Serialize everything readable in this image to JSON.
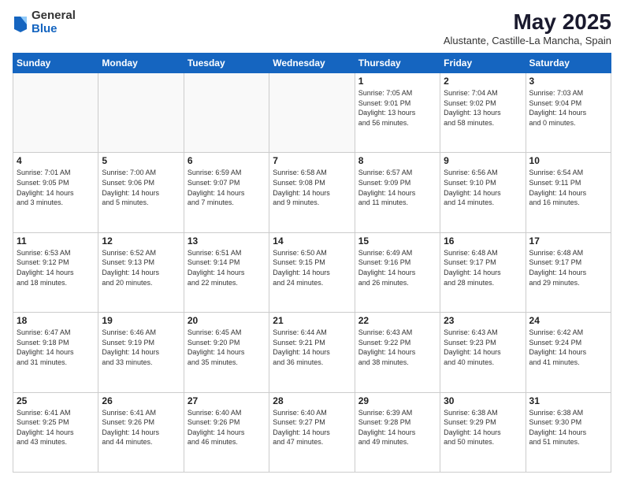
{
  "logo": {
    "general": "General",
    "blue": "Blue"
  },
  "header": {
    "month": "May 2025",
    "location": "Alustante, Castille-La Mancha, Spain"
  },
  "weekdays": [
    "Sunday",
    "Monday",
    "Tuesday",
    "Wednesday",
    "Thursday",
    "Friday",
    "Saturday"
  ],
  "days": [
    {
      "num": "",
      "info": ""
    },
    {
      "num": "",
      "info": ""
    },
    {
      "num": "",
      "info": ""
    },
    {
      "num": "",
      "info": ""
    },
    {
      "num": "1",
      "info": "Sunrise: 7:05 AM\nSunset: 9:01 PM\nDaylight: 13 hours\nand 56 minutes."
    },
    {
      "num": "2",
      "info": "Sunrise: 7:04 AM\nSunset: 9:02 PM\nDaylight: 13 hours\nand 58 minutes."
    },
    {
      "num": "3",
      "info": "Sunrise: 7:03 AM\nSunset: 9:04 PM\nDaylight: 14 hours\nand 0 minutes."
    },
    {
      "num": "4",
      "info": "Sunrise: 7:01 AM\nSunset: 9:05 PM\nDaylight: 14 hours\nand 3 minutes."
    },
    {
      "num": "5",
      "info": "Sunrise: 7:00 AM\nSunset: 9:06 PM\nDaylight: 14 hours\nand 5 minutes."
    },
    {
      "num": "6",
      "info": "Sunrise: 6:59 AM\nSunset: 9:07 PM\nDaylight: 14 hours\nand 7 minutes."
    },
    {
      "num": "7",
      "info": "Sunrise: 6:58 AM\nSunset: 9:08 PM\nDaylight: 14 hours\nand 9 minutes."
    },
    {
      "num": "8",
      "info": "Sunrise: 6:57 AM\nSunset: 9:09 PM\nDaylight: 14 hours\nand 11 minutes."
    },
    {
      "num": "9",
      "info": "Sunrise: 6:56 AM\nSunset: 9:10 PM\nDaylight: 14 hours\nand 14 minutes."
    },
    {
      "num": "10",
      "info": "Sunrise: 6:54 AM\nSunset: 9:11 PM\nDaylight: 14 hours\nand 16 minutes."
    },
    {
      "num": "11",
      "info": "Sunrise: 6:53 AM\nSunset: 9:12 PM\nDaylight: 14 hours\nand 18 minutes."
    },
    {
      "num": "12",
      "info": "Sunrise: 6:52 AM\nSunset: 9:13 PM\nDaylight: 14 hours\nand 20 minutes."
    },
    {
      "num": "13",
      "info": "Sunrise: 6:51 AM\nSunset: 9:14 PM\nDaylight: 14 hours\nand 22 minutes."
    },
    {
      "num": "14",
      "info": "Sunrise: 6:50 AM\nSunset: 9:15 PM\nDaylight: 14 hours\nand 24 minutes."
    },
    {
      "num": "15",
      "info": "Sunrise: 6:49 AM\nSunset: 9:16 PM\nDaylight: 14 hours\nand 26 minutes."
    },
    {
      "num": "16",
      "info": "Sunrise: 6:48 AM\nSunset: 9:17 PM\nDaylight: 14 hours\nand 28 minutes."
    },
    {
      "num": "17",
      "info": "Sunrise: 6:48 AM\nSunset: 9:17 PM\nDaylight: 14 hours\nand 29 minutes."
    },
    {
      "num": "18",
      "info": "Sunrise: 6:47 AM\nSunset: 9:18 PM\nDaylight: 14 hours\nand 31 minutes."
    },
    {
      "num": "19",
      "info": "Sunrise: 6:46 AM\nSunset: 9:19 PM\nDaylight: 14 hours\nand 33 minutes."
    },
    {
      "num": "20",
      "info": "Sunrise: 6:45 AM\nSunset: 9:20 PM\nDaylight: 14 hours\nand 35 minutes."
    },
    {
      "num": "21",
      "info": "Sunrise: 6:44 AM\nSunset: 9:21 PM\nDaylight: 14 hours\nand 36 minutes."
    },
    {
      "num": "22",
      "info": "Sunrise: 6:43 AM\nSunset: 9:22 PM\nDaylight: 14 hours\nand 38 minutes."
    },
    {
      "num": "23",
      "info": "Sunrise: 6:43 AM\nSunset: 9:23 PM\nDaylight: 14 hours\nand 40 minutes."
    },
    {
      "num": "24",
      "info": "Sunrise: 6:42 AM\nSunset: 9:24 PM\nDaylight: 14 hours\nand 41 minutes."
    },
    {
      "num": "25",
      "info": "Sunrise: 6:41 AM\nSunset: 9:25 PM\nDaylight: 14 hours\nand 43 minutes."
    },
    {
      "num": "26",
      "info": "Sunrise: 6:41 AM\nSunset: 9:26 PM\nDaylight: 14 hours\nand 44 minutes."
    },
    {
      "num": "27",
      "info": "Sunrise: 6:40 AM\nSunset: 9:26 PM\nDaylight: 14 hours\nand 46 minutes."
    },
    {
      "num": "28",
      "info": "Sunrise: 6:40 AM\nSunset: 9:27 PM\nDaylight: 14 hours\nand 47 minutes."
    },
    {
      "num": "29",
      "info": "Sunrise: 6:39 AM\nSunset: 9:28 PM\nDaylight: 14 hours\nand 49 minutes."
    },
    {
      "num": "30",
      "info": "Sunrise: 6:38 AM\nSunset: 9:29 PM\nDaylight: 14 hours\nand 50 minutes."
    },
    {
      "num": "31",
      "info": "Sunrise: 6:38 AM\nSunset: 9:30 PM\nDaylight: 14 hours\nand 51 minutes."
    },
    {
      "num": "",
      "info": ""
    },
    {
      "num": "",
      "info": ""
    },
    {
      "num": "",
      "info": ""
    },
    {
      "num": "",
      "info": ""
    },
    {
      "num": "",
      "info": ""
    },
    {
      "num": "",
      "info": ""
    },
    {
      "num": "",
      "info": ""
    }
  ]
}
